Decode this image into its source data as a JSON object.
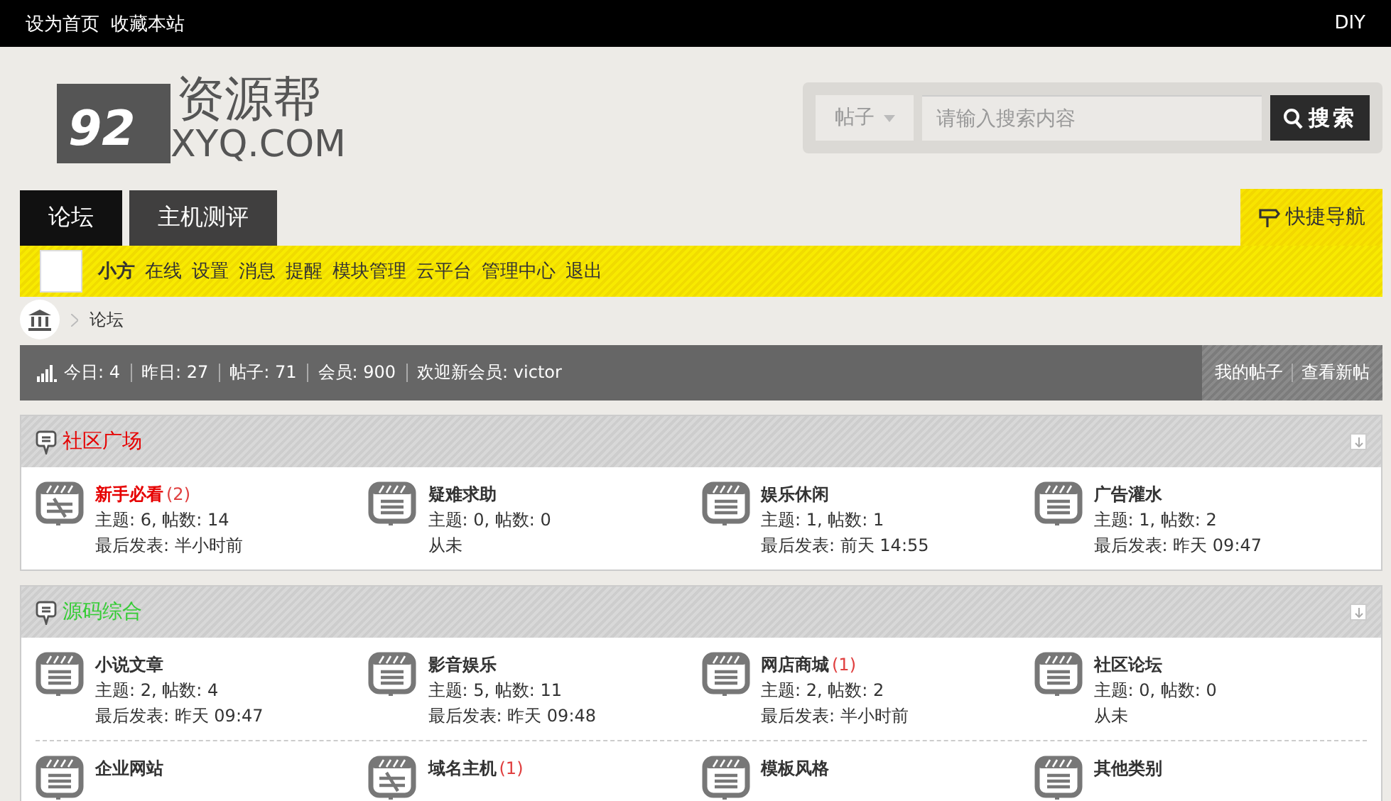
{
  "top_bar": {
    "links": [
      "设为首页",
      "收藏本站"
    ],
    "right_link": "DIY"
  },
  "logo": {
    "title": "资源帮",
    "domain": "XYQ.COM",
    "badge": "92"
  },
  "search": {
    "type_label": "帖子",
    "placeholder": "请输入搜索内容",
    "button": "搜索"
  },
  "nav_tabs": [
    {
      "label": "论坛",
      "selected": true
    },
    {
      "label": "主机测评",
      "selected": false
    }
  ],
  "quick_nav": "快捷导航",
  "user_bar": {
    "username": "小方",
    "links": [
      "在线",
      "设置",
      "消息",
      "提醒",
      "模块管理",
      "云平台",
      "管理中心",
      "退出"
    ]
  },
  "breadcrumb": [
    "论坛"
  ],
  "stats": {
    "items": [
      "今日: 4",
      "昨日: 27",
      "帖子: 71",
      "会员: 900",
      "欢迎新会员: victor"
    ],
    "links": [
      "我的帖子",
      "查看新帖"
    ]
  },
  "sections": [
    {
      "title": "社区广场",
      "color": "#e60000",
      "forums": [
        {
          "name": "新手必看",
          "count": "(2)",
          "has_new": true,
          "highlight": true,
          "stats": "主题: 6, 帖数: 14",
          "last": "最后发表: 半小时前"
        },
        {
          "name": "疑难求助",
          "has_new": false,
          "highlight": false,
          "stats": "主题: 0, 帖数: 0",
          "last": "从未"
        },
        {
          "name": "娱乐休闲",
          "has_new": false,
          "highlight": false,
          "stats": "主题: 1, 帖数: 1",
          "last": "最后发表: 前天 14:55"
        },
        {
          "name": "广告灌水",
          "has_new": false,
          "highlight": false,
          "stats": "主题: 1, 帖数: 2",
          "last": "最后发表: 昨天 09:47"
        }
      ]
    },
    {
      "title": "源码综合",
      "color": "#33cc33",
      "forums": [
        {
          "name": "小说文章",
          "has_new": false,
          "highlight": false,
          "stats": "主题: 2, 帖数: 4",
          "last": "最后发表: 昨天 09:47"
        },
        {
          "name": "影音娱乐",
          "has_new": false,
          "highlight": false,
          "stats": "主题: 5, 帖数: 11",
          "last": "最后发表: 昨天 09:48"
        },
        {
          "name": "网店商城",
          "count": "(1)",
          "has_new": false,
          "highlight": false,
          "stats": "主题: 2, 帖数: 2",
          "last": "最后发表: 半小时前"
        },
        {
          "name": "社区论坛",
          "has_new": false,
          "highlight": false,
          "stats": "主题: 0, 帖数: 0",
          "last": "从未"
        },
        {
          "name": "企业网站",
          "has_new": false,
          "highlight": false
        },
        {
          "name": "域名主机",
          "count": "(1)",
          "has_new": true,
          "highlight": false
        },
        {
          "name": "模板风格",
          "has_new": false,
          "highlight": false
        },
        {
          "name": "其他类别",
          "has_new": false,
          "highlight": false
        }
      ]
    }
  ]
}
